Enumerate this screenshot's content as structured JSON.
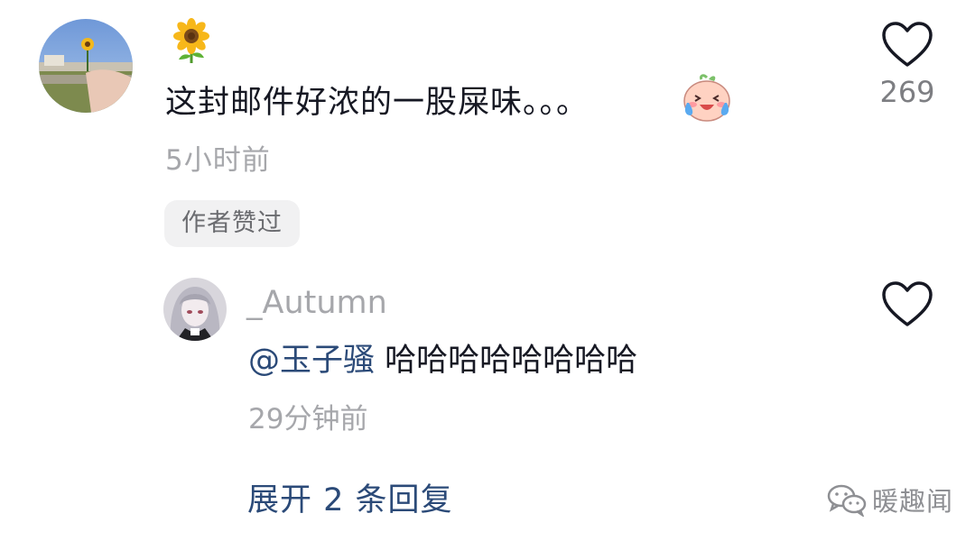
{
  "comment": {
    "username_icon": "sunflower-emoji",
    "text": "这封邮件好浓的一股屎味。。。",
    "text_emoji": "laughing-crying-emoji",
    "time": "5小时前",
    "author_liked_badge": "作者赞过",
    "like_icon": "heart-outline-icon",
    "like_count": "269"
  },
  "reply": {
    "username": "_Autumn",
    "mention": "@玉子骚",
    "text": " 哈哈哈哈哈哈哈哈",
    "time": "29分钟前",
    "like_icon": "heart-outline-icon"
  },
  "expand_replies": "展开 2 条回复",
  "watermark": {
    "icon": "wechat-icon",
    "text": "暖趣闻"
  },
  "colors": {
    "text_primary": "#161823",
    "text_secondary": "#a6a7ab",
    "link": "#2b4a78",
    "badge_bg": "#f1f1f2"
  }
}
